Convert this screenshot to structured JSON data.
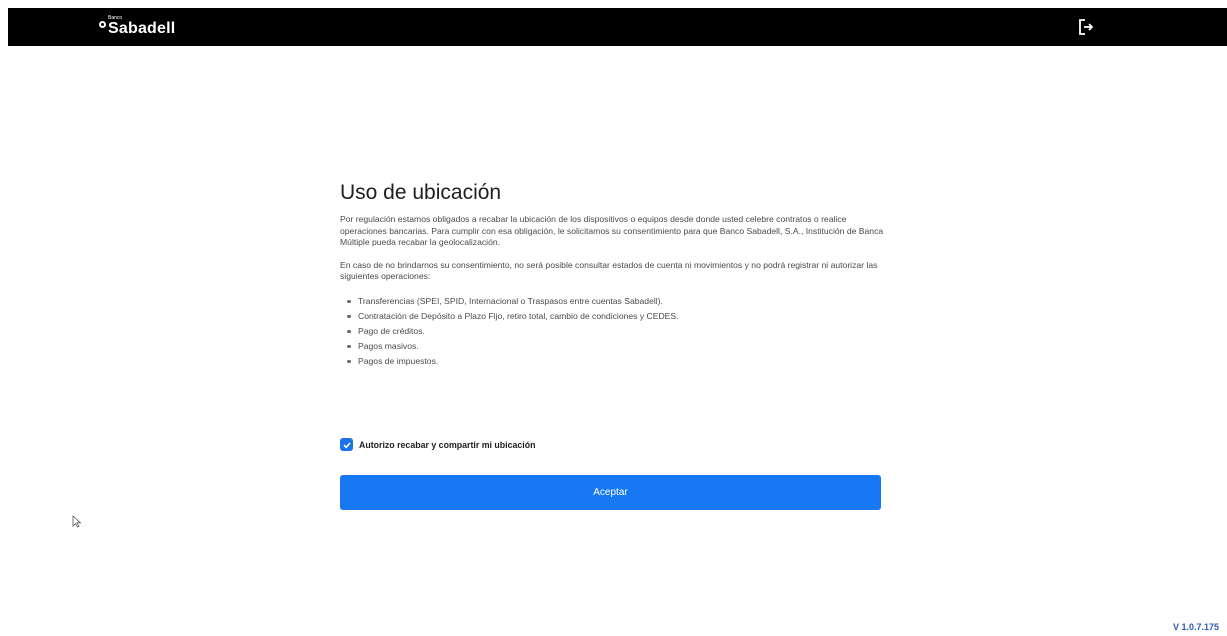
{
  "header": {
    "logo_small": "Banco",
    "logo_name": "Sabadell",
    "logout_icon": "logout-icon"
  },
  "main": {
    "title": "Uso de ubicación",
    "paragraph1": "Por regulación estamos obligados a recabar la ubicación de los dispositivos o equipos desde donde usted celebre contratos o realice operaciones bancarias. Para cumplir con esa obligación, le solicitamos su consentimiento para que Banco Sabadell, S.A., Institución de Banca Múltiple pueda recabar la geolocalización.",
    "paragraph2": "En caso de no brindarnos su consentimiento, no será posible consultar estados de cuenta ni movimientos y no podrá registrar ni autorizar las siguientes operaciones:",
    "operations": [
      "Transferencias (SPEI, SPID, Internacional o Traspasos entre cuentas Sabadell).",
      "Contratación de Depósito a Plazo Fijo, retiro total, cambio de condiciones y CEDES.",
      "Pago de créditos.",
      "Pagos masivos.",
      "Pagos de impuestos."
    ],
    "consent_label": "Autorizo recabar y compartir mi ubicación",
    "consent_checked": true,
    "accept_label": "Aceptar"
  },
  "footer": {
    "version": "V 1.0.7.175"
  },
  "colors": {
    "header_bg": "#000000",
    "accent": "#1877f2",
    "version_text": "#2f5aa8"
  }
}
